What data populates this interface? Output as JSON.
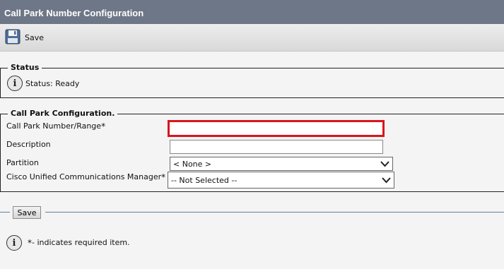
{
  "window": {
    "title": "Call Park Number Configuration"
  },
  "toolbar": {
    "save_label": "Save",
    "save_icon": "floppy-disk-icon"
  },
  "status": {
    "legend": "Status",
    "icon": "info-icon",
    "text": "Status: Ready"
  },
  "config": {
    "legend": "Call Park Configuration.",
    "fields": {
      "number_range": {
        "label": "Call Park Number/Range",
        "required_mark": "*",
        "value": ""
      },
      "description": {
        "label": "Description",
        "value": ""
      },
      "partition": {
        "label": "Partition",
        "selected": "< None >"
      },
      "ucm": {
        "label": "Cisco Unified Communications Manager",
        "required_mark": "*",
        "selected": "-- Not Selected --"
      }
    },
    "highlight_color": "#d8161c"
  },
  "footer": {
    "save_label": "Save",
    "note_mark": "*",
    "note_text": "- indicates required item."
  }
}
